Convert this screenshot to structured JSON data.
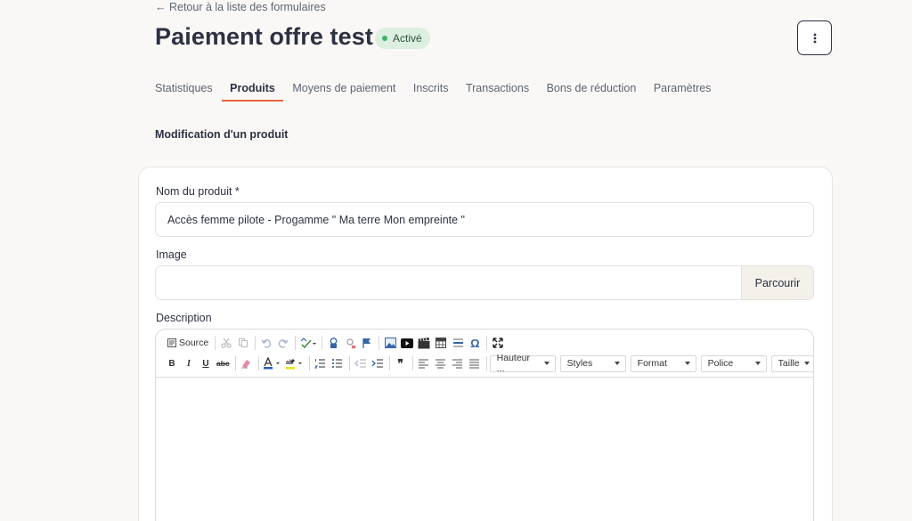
{
  "back_link": "← Retour à la liste des formulaires",
  "title": "Paiement offre test",
  "status": "Activé",
  "more_glyph": "⋮",
  "tabs": [
    {
      "label": "Statistiques"
    },
    {
      "label": "Produits"
    },
    {
      "label": "Moyens de paiement"
    },
    {
      "label": "Inscrits"
    },
    {
      "label": "Transactions"
    },
    {
      "label": "Bons de réduction"
    },
    {
      "label": "Paramètres"
    }
  ],
  "active_tab": "Produits",
  "section_heading": "Modification d'un produit",
  "form": {
    "name_label": "Nom du produit *",
    "name_value": "Accès femme pilote - Progamme \" Ma terre Mon empreinte \"",
    "image_label": "Image",
    "browse_label": "Parcourir",
    "description_label": "Description"
  },
  "editor": {
    "source_label": "Source",
    "combos": {
      "heading": "Hauteur ...",
      "styles": "Styles",
      "format": "Format",
      "font": "Police",
      "size": "Taille"
    },
    "glyphs": {
      "bold": "B",
      "italic": "I",
      "underline": "U",
      "strike": "abc",
      "omega": "Ω",
      "quote": "❞"
    }
  },
  "colors": {
    "accent": "#e8643c",
    "status_bg": "#dcefe1",
    "status_dot": "#41b06b",
    "text": "#2d3142"
  }
}
